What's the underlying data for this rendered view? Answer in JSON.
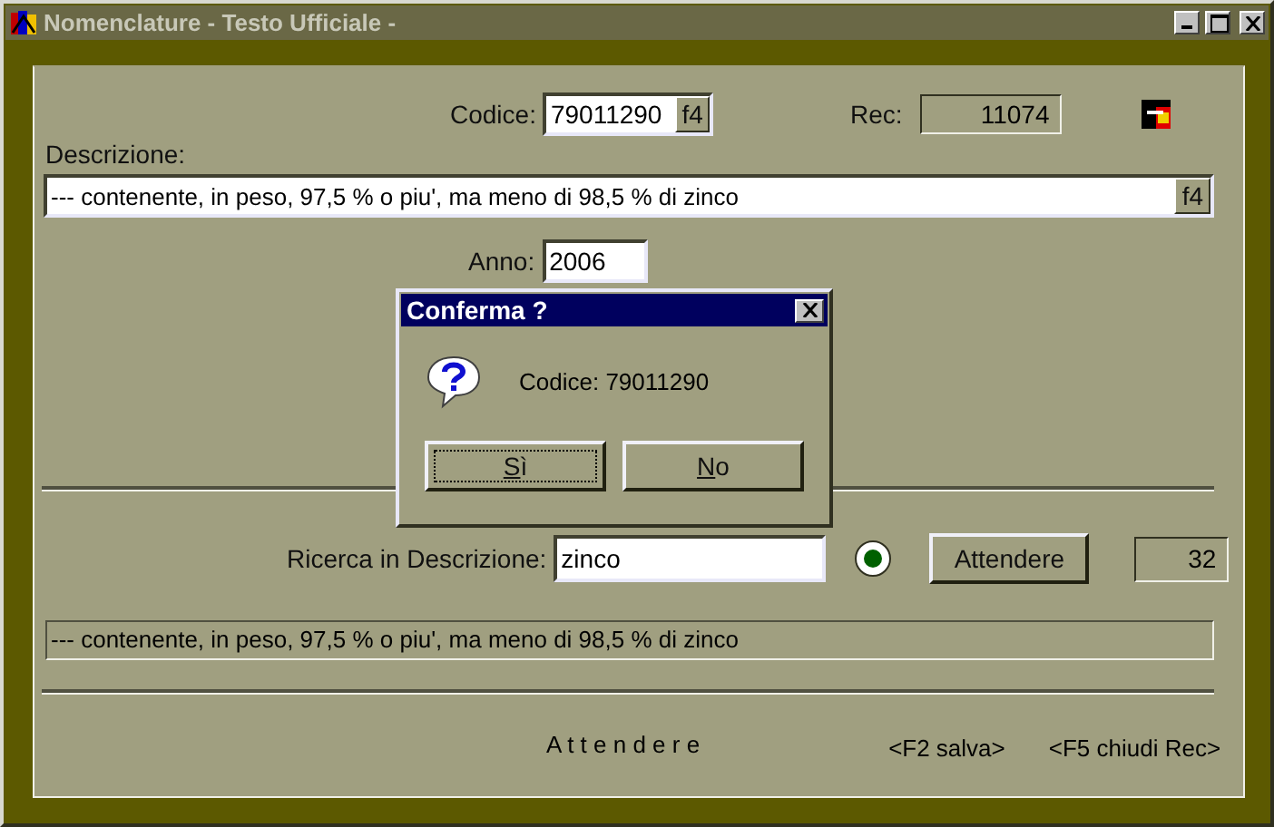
{
  "window": {
    "title": "Nomenclature - Testo Ufficiale -"
  },
  "codice": {
    "label": "Codice:",
    "value": "79011290",
    "lookup": "f4"
  },
  "rec": {
    "label": "Rec:",
    "value": "11074"
  },
  "descrizione": {
    "label": "Descrizione:",
    "value": "--- contenente, in peso, 97,5 % o piu', ma meno di 98,5 % di zinco",
    "lookup": "f4"
  },
  "anno": {
    "label": "Anno:",
    "value": "2006"
  },
  "dialog": {
    "title": "Conferma ?",
    "message": "Codice: 79011290",
    "buttons": [
      {
        "label": "Sì",
        "focused": true
      },
      {
        "label": "No",
        "focused": false
      }
    ]
  },
  "ricerca": {
    "label": "Ricerca in Descrizione:",
    "value": "zinco",
    "radio_selected": true,
    "button": "Attendere",
    "count": "32"
  },
  "result": "--- contenente, in peso, 97,5 % o piu', ma meno di 98,5 % di zinco",
  "footer": {
    "status": "A t t e n d e r e",
    "keys": [
      "<F2 salva>",
      "<F5 chiudi Rec>"
    ]
  }
}
